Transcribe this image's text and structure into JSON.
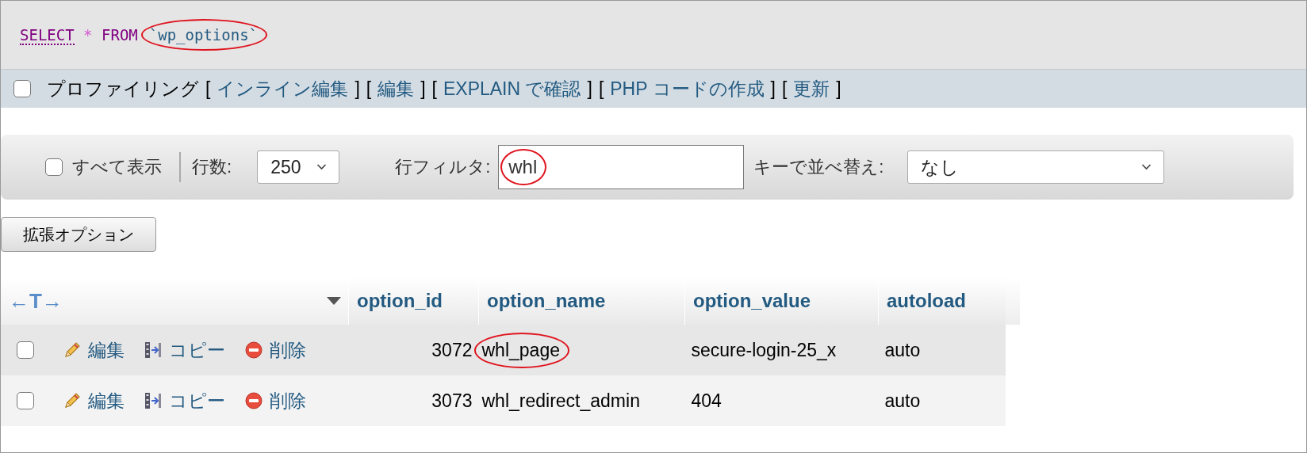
{
  "query": {
    "select": "SELECT",
    "star": "*",
    "from": "FROM",
    "table": "`wp_options`",
    "table_circled": true
  },
  "actions": {
    "profiling": {
      "label": "プロファイリング",
      "checked": false
    },
    "links": [
      {
        "open": "[",
        "text": "インライン編集",
        "close": "]"
      },
      {
        "open": "[",
        "text": "編集",
        "close": "]"
      },
      {
        "open": "[",
        "text": "EXPLAIN で確認",
        "close": "]"
      },
      {
        "open": "[",
        "text": "PHP コードの作成",
        "close": "]"
      },
      {
        "open": "[",
        "text": "更新",
        "close": "]"
      }
    ]
  },
  "filter": {
    "show_all": {
      "label": "すべて表示",
      "checked": false
    },
    "rows_label": "行数:",
    "rows_value": "250",
    "filter_label": "行フィルタ:",
    "filter_value": "whl",
    "filter_circled": true,
    "sort_label": "キーで並べ替え:",
    "sort_value": "なし"
  },
  "options_button": "拡張オプション",
  "table": {
    "toggle": "←T→",
    "columns": [
      "option_id",
      "option_name",
      "option_value",
      "autoload"
    ],
    "rows": [
      {
        "checked": false,
        "actions": [
          {
            "kind": "edit",
            "label": "編集"
          },
          {
            "kind": "copy",
            "label": "コピー"
          },
          {
            "kind": "delete",
            "label": "削除"
          }
        ],
        "cells": [
          {
            "text": "3072",
            "circled": false
          },
          {
            "text": "whl_page",
            "circled": true
          },
          {
            "text": "secure-login-25_x",
            "circled": false
          },
          {
            "text": "auto",
            "circled": false
          }
        ]
      },
      {
        "checked": false,
        "actions": [
          {
            "kind": "edit",
            "label": "編集"
          },
          {
            "kind": "copy",
            "label": "コピー"
          },
          {
            "kind": "delete",
            "label": "削除"
          }
        ],
        "cells": [
          {
            "text": "3073",
            "circled": false
          },
          {
            "text": "whl_redirect_admin",
            "circled": false
          },
          {
            "text": "404",
            "circled": false
          },
          {
            "text": "auto",
            "circled": false
          }
        ]
      }
    ]
  }
}
